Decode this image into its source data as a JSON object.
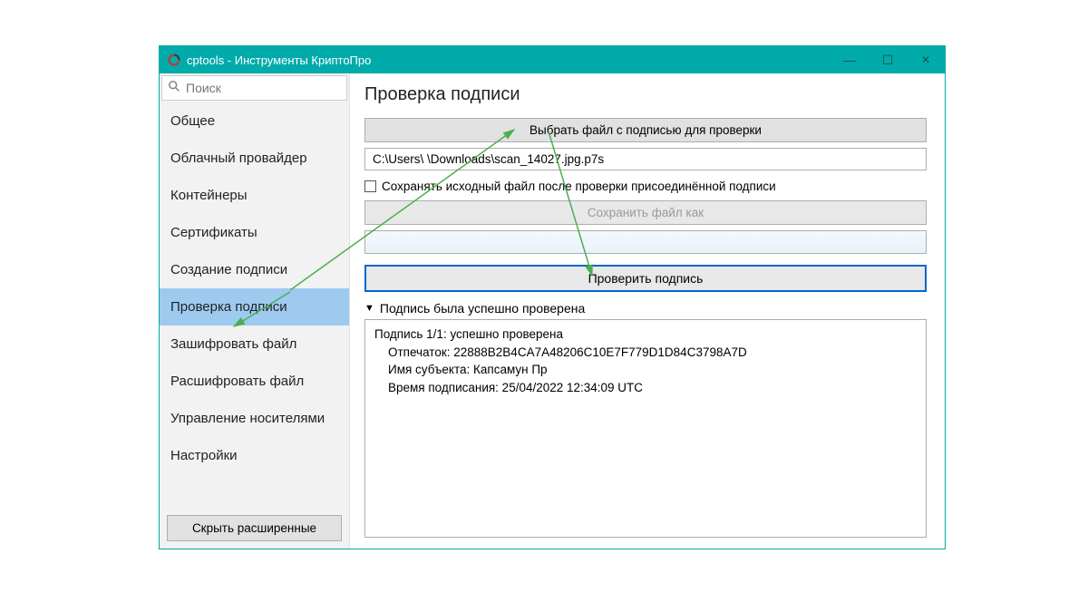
{
  "window": {
    "title": "cptools - Инструменты КриптоПро"
  },
  "sidebar": {
    "search_placeholder": "Поиск",
    "items": [
      {
        "label": "Общее"
      },
      {
        "label": "Облачный провайдер"
      },
      {
        "label": "Контейнеры"
      },
      {
        "label": "Сертификаты"
      },
      {
        "label": "Создание подписи"
      },
      {
        "label": "Проверка подписи"
      },
      {
        "label": "Зашифровать файл"
      },
      {
        "label": "Расшифровать файл"
      },
      {
        "label": "Управление носителями"
      },
      {
        "label": "Настройки"
      }
    ],
    "hide_advanced": "Скрыть расширенные"
  },
  "main": {
    "title": "Проверка подписи",
    "choose_file_btn": "Выбрать файл с подписью для проверки",
    "file_path": "C:\\Users\\            \\Downloads\\scan_14027.jpg.p7s",
    "save_source_checkbox": "Сохранять исходный файл после проверки присоединённой подписи",
    "save_as_btn": "Сохранить файл как",
    "verify_btn": "Проверить подпись",
    "status_summary": "Подпись была успешно проверена",
    "result_text": "Подпись 1/1: успешно проверена\n    Отпечаток: 22888B2B4CA7A48206C10E7F779D1D84C3798A7D\n    Имя субъекта: Капсамун Пр\n    Время подписания: 25/04/2022 12:34:09 UTC"
  }
}
